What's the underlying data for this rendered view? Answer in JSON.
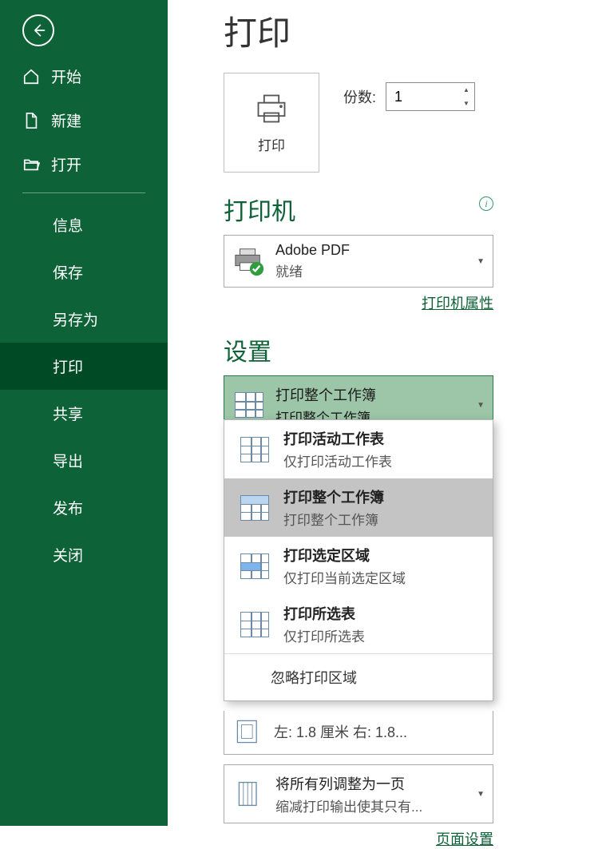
{
  "sidebar": {
    "nav": {
      "home": "开始",
      "new": "新建",
      "open": "打开"
    },
    "sub": {
      "info": "信息",
      "save": "保存",
      "saveas": "另存为",
      "print": "打印",
      "share": "共享",
      "export": "导出",
      "publish": "发布",
      "close": "关闭"
    }
  },
  "main": {
    "title": "打印",
    "print_button": "打印",
    "copies_label": "份数:",
    "copies_value": "1",
    "printer_section": "打印机",
    "printer_name": "Adobe PDF",
    "printer_status": "就绪",
    "printer_props": "打印机属性",
    "settings_section": "设置",
    "print_what": {
      "title": "打印整个工作簿",
      "sub": "打印整个工作簿"
    },
    "popup": {
      "opt1_t": "打印活动工作表",
      "opt1_s": "仅打印活动工作表",
      "opt2_t": "打印整个工作簿",
      "opt2_s": "打印整个工作簿",
      "opt3_t": "打印选定区域",
      "opt3_s": "仅打印当前选定区域",
      "opt4_t": "打印所选表",
      "opt4_s": "仅打印所选表",
      "footer": "忽略打印区域"
    },
    "margins": "左:  1.8 厘米    右:  1.8...",
    "scaling": {
      "title": "将所有列调整为一页",
      "sub": "缩减打印输出使其只有..."
    },
    "page_setup": "页面设置"
  }
}
